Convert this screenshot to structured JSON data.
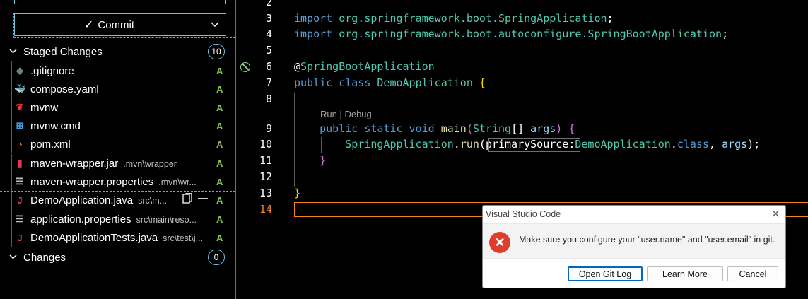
{
  "sidebar": {
    "commit_label": "Commit",
    "commit_icon": "checkmark-icon",
    "staged": {
      "label": "Staged Changes",
      "count": "10"
    },
    "changes": {
      "label": "Changes",
      "count": "0"
    },
    "files": [
      {
        "name": ".gitignore",
        "path": "",
        "status": "A",
        "icon": "gitignore-icon",
        "glyph": "◆",
        "color": "#6d8086"
      },
      {
        "name": "compose.yaml",
        "path": "",
        "status": "A",
        "icon": "docker-icon",
        "glyph": "🐳",
        "color": "#e37933"
      },
      {
        "name": "mvnw",
        "path": "",
        "status": "A",
        "icon": "maven-icon",
        "glyph": "❦",
        "color": "#e53935"
      },
      {
        "name": "mvnw.cmd",
        "path": "",
        "status": "A",
        "icon": "windows-icon",
        "glyph": "⊞",
        "color": "#3f9fe0"
      },
      {
        "name": "pom.xml",
        "path": "",
        "status": "A",
        "icon": "rss-icon",
        "glyph": "◔",
        "color": "#e37933"
      },
      {
        "name": "maven-wrapper.jar",
        "path": ".mvn\\wrapper",
        "status": "A",
        "icon": "jar-icon",
        "glyph": "▮",
        "color": "#e53950"
      },
      {
        "name": "maven-wrapper.properties",
        "path": ".mvn\\wr...",
        "status": "A",
        "icon": "properties-icon",
        "glyph": "☰",
        "color": "#c0c0c0"
      },
      {
        "name": "DemoApplication.java",
        "path": "src\\m...",
        "status": "A",
        "icon": "java-icon",
        "glyph": "J",
        "color": "#e53950"
      },
      {
        "name": "application.properties",
        "path": "src\\main\\reso...",
        "status": "A",
        "icon": "properties-icon",
        "glyph": "☰",
        "color": "#c0c0c0"
      },
      {
        "name": "DemoApplicationTests.java",
        "path": "src\\test\\j...",
        "status": "A",
        "icon": "java-icon",
        "glyph": "J",
        "color": "#e53950"
      }
    ]
  },
  "editor": {
    "line_numbers": [
      "2",
      "3",
      "4",
      "5",
      "6",
      "7",
      "8",
      "9",
      "10",
      "11",
      "12",
      "13",
      "14"
    ],
    "active_line": "14",
    "codelens": "Run | Debug",
    "code": {
      "l3_kw": "import",
      "l3_pkg": "org.springframework.boot.SpringApplication",
      "l3_end": ";",
      "l4_kw": "import",
      "l4_pkg": "org.springframework.boot.autoconfigure.SpringBootApplication",
      "l4_end": ";",
      "l6_at": "@",
      "l6_ann": "SpringBootApplication",
      "l7_kw": "public class",
      "l7_cls": "DemoApplication",
      "l7_brace": "{",
      "l9_kw": "public static void",
      "l9_fn": "main",
      "l9_p1": "(",
      "l9_type": "String",
      "l9_p2": "[]",
      "l9_arg": "args",
      "l9_p3": ")",
      "l9_brace": "{",
      "l10_cls": "SpringApplication",
      "l10_dot": ".",
      "l10_fn": "run",
      "l10_p1": "(",
      "l10_hint": "primarySource:",
      "l10_cls2": "DemoApplication",
      "l10_dot2": ".",
      "l10_kw": "class",
      "l10_comma": ", ",
      "l10_arg": "args",
      "l10_end": ");",
      "l11_brace": "}",
      "l13_brace": "}"
    }
  },
  "dialog": {
    "title": "Visual Studio Code",
    "message": "Make sure you configure your \"user.name\" and \"user.email\" in git.",
    "close_glyph": "✕",
    "error_glyph": "✕",
    "buttons": {
      "open_git_log": "Open Git Log",
      "learn_more": "Learn More",
      "cancel": "Cancel"
    }
  },
  "colors": {
    "focus_border": "#f38518",
    "contrast_border": "#6fc3df",
    "added": "#8bc34a",
    "error": "#e03e2d"
  }
}
